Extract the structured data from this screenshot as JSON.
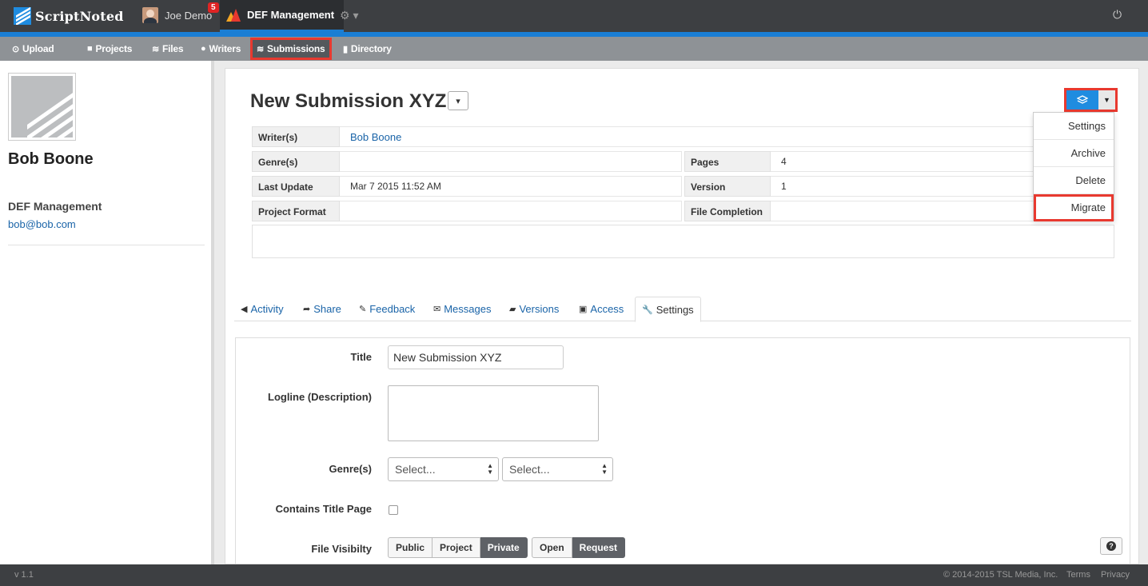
{
  "app": {
    "logo_text": "ScriptNoted"
  },
  "topbar": {
    "user_name": "Joe Demo",
    "notification_count": "5",
    "org_name": "DEF Management",
    "settings_icon": "gear-icon",
    "power_icon": "power-icon"
  },
  "nav": {
    "items": [
      {
        "label": "Upload",
        "icon": "upload-icon"
      },
      {
        "label": "Projects",
        "icon": "folder-icon"
      },
      {
        "label": "Files",
        "icon": "layers-icon"
      },
      {
        "label": "Writers",
        "icon": "user-icon"
      },
      {
        "label": "Submissions",
        "icon": "layers-icon",
        "active": true
      },
      {
        "label": "Directory",
        "icon": "book-icon"
      }
    ]
  },
  "sidebar": {
    "name": "Bob Boone",
    "org": "DEF Management",
    "email": "bob@bob.com"
  },
  "submission": {
    "title": "New Submission XYZ",
    "fields": {
      "writers_label": "Writer(s)",
      "writers_value": "Bob Boone",
      "genres_label": "Genre(s)",
      "genres_value": "",
      "pages_label": "Pages",
      "pages_value": "4",
      "last_update_label": "Last Update",
      "last_update_value": "Mar 7 2015 11:52 AM",
      "version_label": "Version",
      "version_value": "1",
      "project_format_label": "Project Format",
      "project_format_value": "",
      "file_completion_label": "File Completion",
      "file_completion_value": ""
    }
  },
  "actions_menu": {
    "items": [
      "Settings",
      "Archive",
      "Delete",
      "Migrate"
    ],
    "highlighted": "Migrate"
  },
  "tabs": [
    {
      "label": "Activity",
      "icon": "megaphone-icon"
    },
    {
      "label": "Share",
      "icon": "share-icon"
    },
    {
      "label": "Feedback",
      "icon": "pencil-icon"
    },
    {
      "label": "Messages",
      "icon": "envelope-icon"
    },
    {
      "label": "Versions",
      "icon": "folder-open-icon"
    },
    {
      "label": "Access",
      "icon": "lock-icon"
    },
    {
      "label": "Settings",
      "icon": "wrench-icon",
      "active": true
    }
  ],
  "settings_form": {
    "title_label": "Title",
    "title_value": "New Submission XYZ",
    "logline_label": "Logline (Description)",
    "logline_value": "",
    "genres_label": "Genre(s)",
    "genre_select_1": "Select...",
    "genre_select_2": "Select...",
    "title_page_label": "Contains Title Page",
    "visibility_label": "File Visibilty",
    "visibility_options": [
      "Public",
      "Project",
      "Private"
    ],
    "visibility_selected": "Private",
    "access_options": [
      "Open",
      "Request"
    ],
    "access_selected": "Request"
  },
  "footer": {
    "version": "v 1.1",
    "copyright": "© 2014-2015 TSL Media, Inc.",
    "terms": "Terms",
    "privacy": "Privacy"
  },
  "colors": {
    "accent": "#1a7ed4",
    "highlight": "#e8392f",
    "topbar": "#3d3f42",
    "navbar": "#8e9296"
  }
}
